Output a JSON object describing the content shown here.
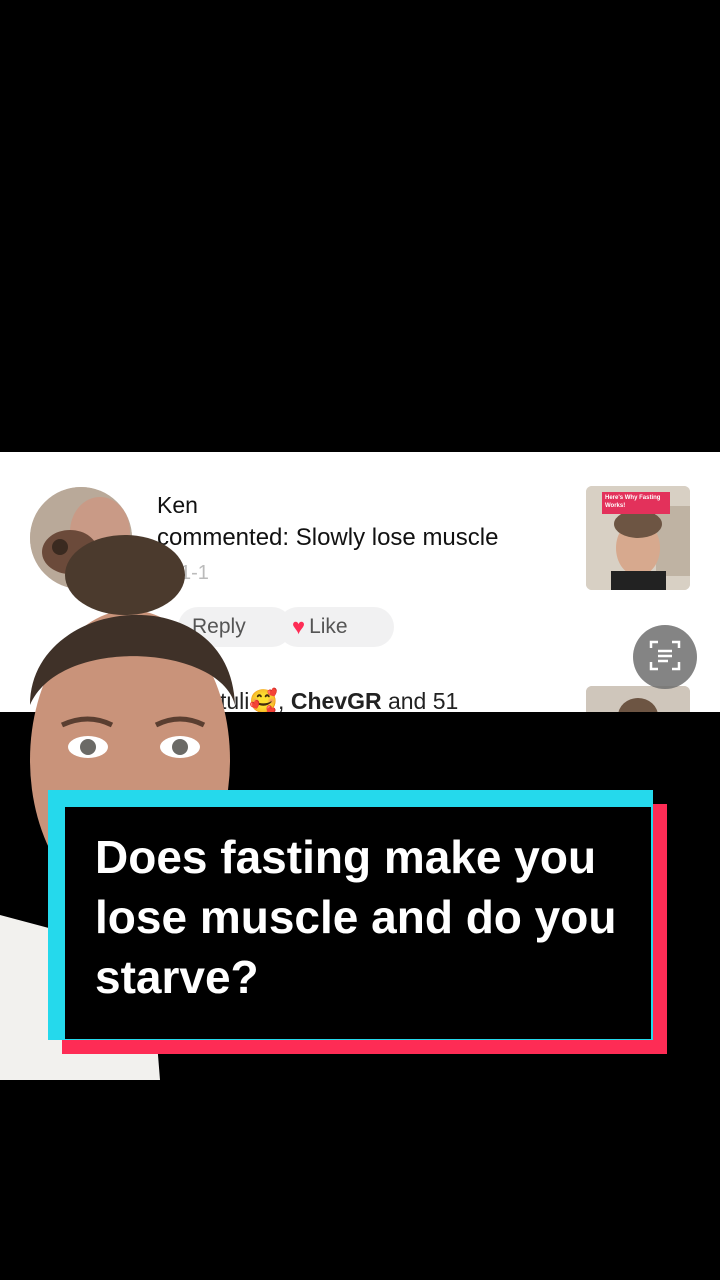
{
  "comment": {
    "username": "Ken",
    "text": "commented: Slowly lose muscle",
    "timestamp": "1-1",
    "reply_label": "Reply",
    "like_label": "Like",
    "thumbnail_banner": "Here's Why Fasting Works!"
  },
  "next_comment": {
    "likes_prefix": "tuli🥰, ",
    "likes_user": "ChevGR",
    "likes_suffix": " and 51"
  },
  "caption": {
    "text": "Does fasting make you lose muscle and do you starve?"
  },
  "icons": {
    "scan": "text-scan-icon",
    "heart": "heart-icon"
  },
  "colors": {
    "accent_red": "#fe2c55",
    "accent_cyan": "#25d9ec"
  }
}
